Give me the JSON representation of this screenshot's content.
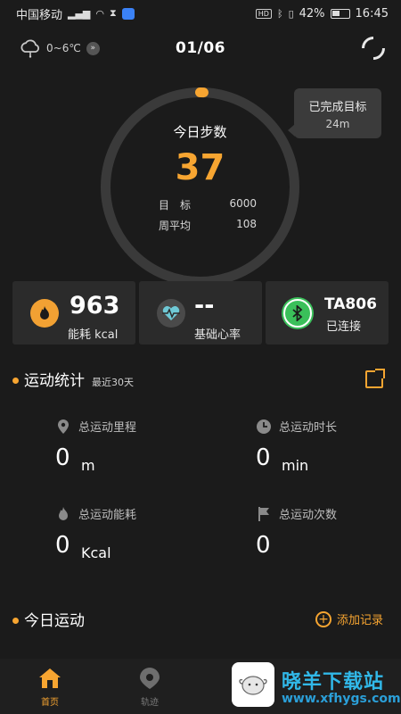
{
  "status_bar": {
    "carrier": "中国移动",
    "signal_label": "4G",
    "battery": "42%",
    "time": "16:45"
  },
  "header": {
    "weather_range": "0~6℃",
    "date": "01/06"
  },
  "steps": {
    "title": "今日步数",
    "value": "37",
    "target_label": "目　标",
    "target_value": "6000",
    "weekly_avg_label": "周平均",
    "weekly_avg_value": "108",
    "progress_fraction": 0.006
  },
  "goal_bubble": {
    "title": "已完成目标",
    "value": "24m"
  },
  "cards": [
    {
      "value": "963",
      "label": "能耗 kcal"
    },
    {
      "value": "--",
      "label": "基础心率"
    },
    {
      "value": "TA806",
      "label": "已连接"
    }
  ],
  "stats_section": {
    "title": "运动统计",
    "subtitle": "最近30天",
    "items": [
      {
        "label": "总运动里程",
        "value": "0",
        "unit": "m"
      },
      {
        "label": "总运动时长",
        "value": "0",
        "unit": "min"
      },
      {
        "label": "总运动能耗",
        "value": "0",
        "unit": "Kcal"
      },
      {
        "label": "总运动次数",
        "value": "0",
        "unit": ""
      }
    ]
  },
  "today_section": {
    "title": "今日运动",
    "add_label": "添加记录"
  },
  "bottom_nav": [
    {
      "label": "首页"
    },
    {
      "label": "轨迹"
    }
  ],
  "watermark": {
    "title": "晓羊下载站",
    "url": "www.xfhygs.com"
  },
  "colors": {
    "accent": "#f7a531",
    "background": "#1b1b1b",
    "card": "#2b2b2b",
    "bluetooth": "#3ac05a"
  }
}
